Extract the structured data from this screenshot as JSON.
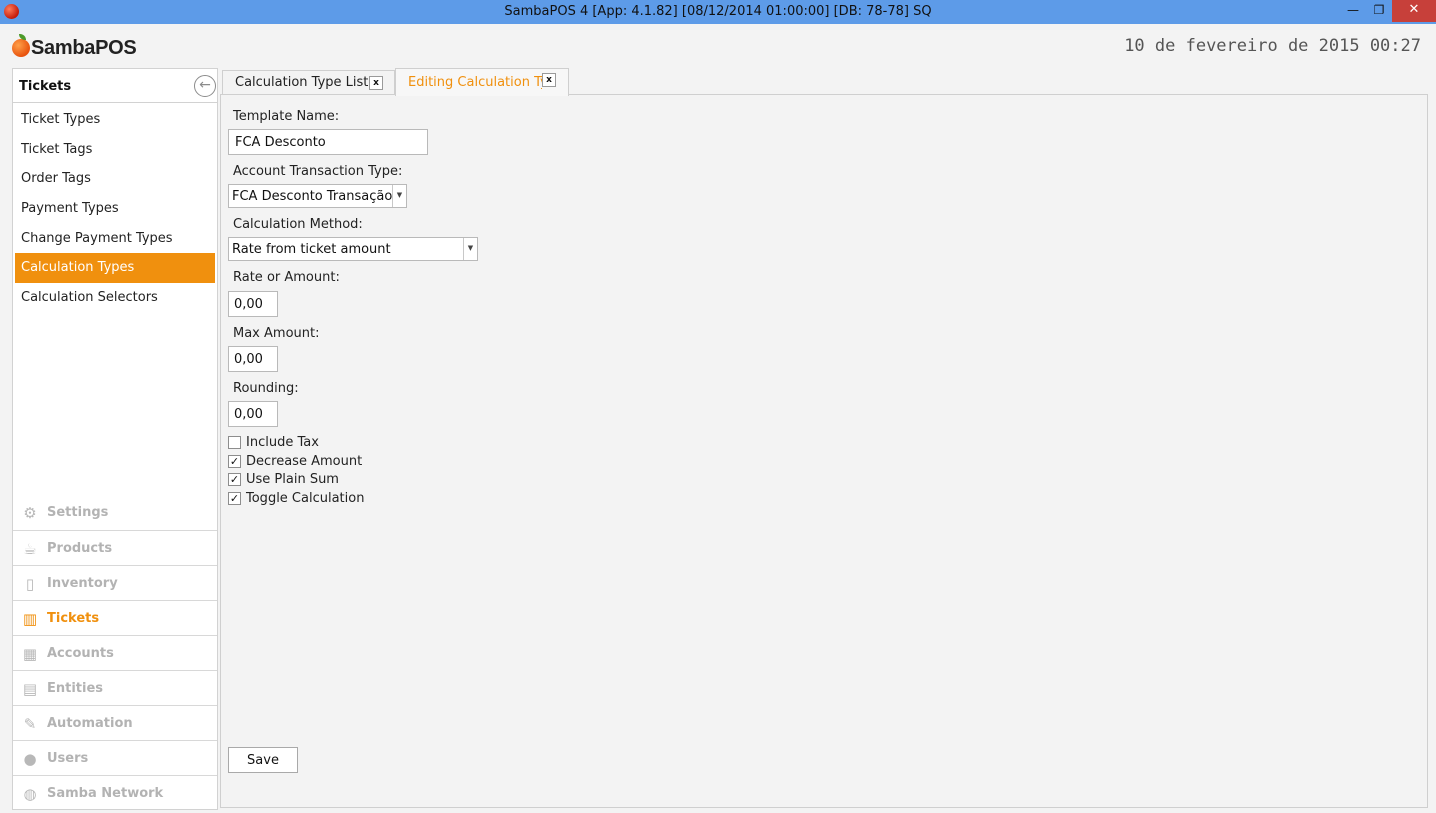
{
  "window": {
    "title": "SambaPOS 4 [App: 4.1.82] [08/12/2014 01:00:00] [DB: 78-78] SQ",
    "minimize": "—",
    "maximize": "❐",
    "close": "✕"
  },
  "header": {
    "logo_text": "SambaPOS",
    "clock": "10 de fevereiro de 2015 00:27"
  },
  "sidebar": {
    "title": "Tickets",
    "back_glyph": "←",
    "items": [
      {
        "label": "Ticket Types"
      },
      {
        "label": "Ticket Tags"
      },
      {
        "label": "Order Tags"
      },
      {
        "label": "Payment Types"
      },
      {
        "label": "Change Payment Types"
      },
      {
        "label": "Calculation Types",
        "active": true
      },
      {
        "label": "Calculation Selectors"
      }
    ],
    "sections": [
      {
        "label": "Settings",
        "icon": "gear-icon",
        "glyph": "⚙"
      },
      {
        "label": "Products",
        "icon": "coffee-cup-icon",
        "glyph": "☕"
      },
      {
        "label": "Inventory",
        "icon": "box-icon",
        "glyph": "▯"
      },
      {
        "label": "Tickets",
        "icon": "books-icon",
        "glyph": "▥",
        "active": true
      },
      {
        "label": "Accounts",
        "icon": "calculator-icon",
        "glyph": "▦"
      },
      {
        "label": "Entities",
        "icon": "grid-icon",
        "glyph": "▤"
      },
      {
        "label": "Automation",
        "icon": "pen-icon",
        "glyph": "✎"
      },
      {
        "label": "Users",
        "icon": "user-icon",
        "glyph": "●"
      },
      {
        "label": "Samba Network",
        "icon": "globe-icon",
        "glyph": "◍"
      }
    ]
  },
  "tabs": [
    {
      "label": "Calculation Type List",
      "close": "x"
    },
    {
      "label": "Editing Calculation Type",
      "close": "x"
    }
  ],
  "form": {
    "template_name_label": "Template Name:",
    "template_name_value": "FCA Desconto",
    "account_transaction_type_label": "Account Transaction Type:",
    "account_transaction_type_value": "FCA Desconto Transação",
    "calculation_method_label": "Calculation Method:",
    "calculation_method_value": "Rate from ticket amount",
    "rate_label": "Rate or Amount:",
    "rate_value": "0,00",
    "max_amount_label": "Max Amount:",
    "max_amount_value": "0,00",
    "rounding_label": "Rounding:",
    "rounding_value": "0,00",
    "checkboxes": [
      {
        "label": "Include Tax",
        "checked": false
      },
      {
        "label": "Decrease Amount",
        "checked": true
      },
      {
        "label": "Use Plain Sum",
        "checked": true
      },
      {
        "label": "Toggle Calculation",
        "checked": true
      }
    ],
    "save_label": "Save"
  },
  "colors": {
    "titlebar": "#5d9be8",
    "accent": "#f0900e",
    "close_button": "#c7403a"
  }
}
